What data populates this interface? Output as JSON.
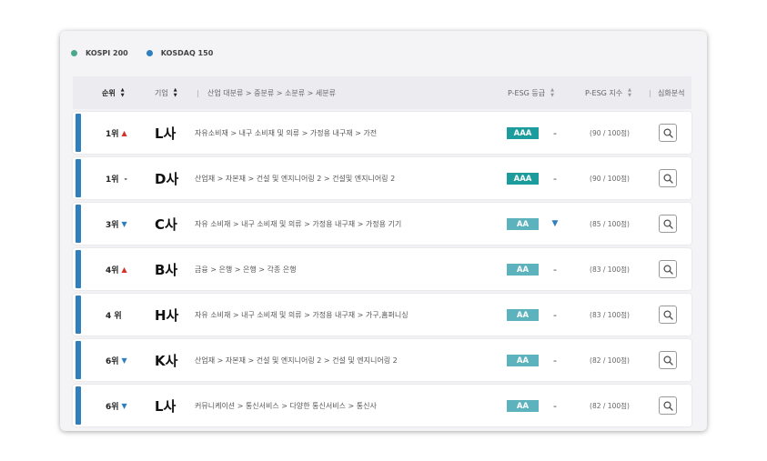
{
  "legend": [
    {
      "label": "KOSPI 200",
      "color": "#4aa88c"
    },
    {
      "label": "KOSDAQ  150",
      "color": "#2f7fbf"
    }
  ],
  "header": {
    "rank": "순위",
    "company": "기업",
    "separator": "|",
    "industry": "산업 대분류 > 중분류 > 소분류 > 세분류",
    "grade": "P-ESG 등급",
    "index": "P-ESG 지수",
    "analysis": "심화분석"
  },
  "colors": {
    "grade_aaa": "#1c9c9c",
    "grade_aa": "#5cb3bd",
    "row_accent": "#2f7fbf",
    "trend_up": "#d0342c",
    "trend_down": "#2f7fbf"
  },
  "rows": [
    {
      "rank": "1위",
      "trend": "up",
      "trend_symbol": "▲",
      "company": "L사",
      "industry": "자유소비재 > 내구 소비재 및 의류 > 가정용 내구재 > 가전",
      "grade": "AAA",
      "change": "-",
      "score": "(90 / 100점)"
    },
    {
      "rank": "1위",
      "trend": "flat",
      "trend_symbol": "-",
      "company": "D사",
      "industry": "산업재 > 자본재 > 건설 및 엔지니어링 2 > 건설및 엔지니어링 2",
      "grade": "AAA",
      "change": "-",
      "score": "(90 / 100점)"
    },
    {
      "rank": "3위",
      "trend": "down",
      "trend_symbol": "▼",
      "company": "C사",
      "industry": "자유 소비재 > 내구 소비재 및 의류 > 가정용 내구재 > 가정용 기기",
      "grade": "AA",
      "change": "▼",
      "score": "(85 / 100점)"
    },
    {
      "rank": "4위",
      "trend": "up",
      "trend_symbol": "▲",
      "company": "B사",
      "industry": "금융 > 은행 > 은행 > 각종 은행",
      "grade": "AA",
      "change": "-",
      "score": "(83 / 100점)"
    },
    {
      "rank": "4 위",
      "trend": "none",
      "trend_symbol": "",
      "company": "H사",
      "industry": "자유 소비재 > 내구 소비재 및 의류 > 가정용 내구재 > 가구,홈퍼니싱",
      "grade": "AA",
      "change": "-",
      "score": "(83 / 100점)"
    },
    {
      "rank": "6위",
      "trend": "down",
      "trend_symbol": "▼",
      "company": "K사",
      "industry": "산업재  > 자본재 > 건설 및 엔지니어링 2 > 건설 및 엔지니어링 2",
      "grade": "AA",
      "change": "-",
      "score": "(82 / 100점)"
    },
    {
      "rank": "6위",
      "trend": "down",
      "trend_symbol": "▼",
      "company": "L사",
      "industry": "커뮤니케이션 > 통신서비스 > 다양한 통신서비스 > 통신사",
      "grade": "AA",
      "change": "-",
      "score": "(82 / 100점)"
    }
  ]
}
